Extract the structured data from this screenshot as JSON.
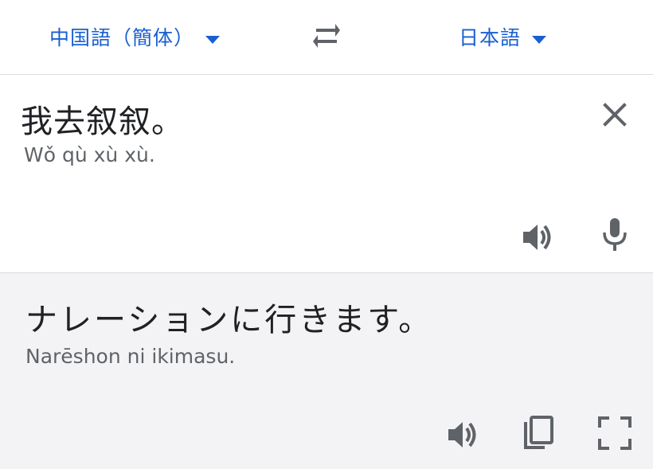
{
  "languages": {
    "source": "中国語（簡体）",
    "target": "日本語",
    "dropdown_icon": "caret-down-icon",
    "swap_icon": "swap-arrows-icon"
  },
  "source": {
    "text": "我去叙叙。",
    "transliteration": "Wǒ qù xù xù.",
    "clear_icon": "close-icon",
    "listen_icon": "speaker-icon",
    "mic_icon": "microphone-icon"
  },
  "translation": {
    "text": "ナレーションに行きます。",
    "transliteration": "Narēshon ni ikimasu.",
    "listen_icon": "speaker-icon",
    "copy_icon": "copy-icon",
    "fullscreen_icon": "fullscreen-icon"
  },
  "colors": {
    "accent": "#1a5fd0",
    "icon": "#5f6368",
    "text": "#202124",
    "result_background": "#f3f3f5"
  }
}
